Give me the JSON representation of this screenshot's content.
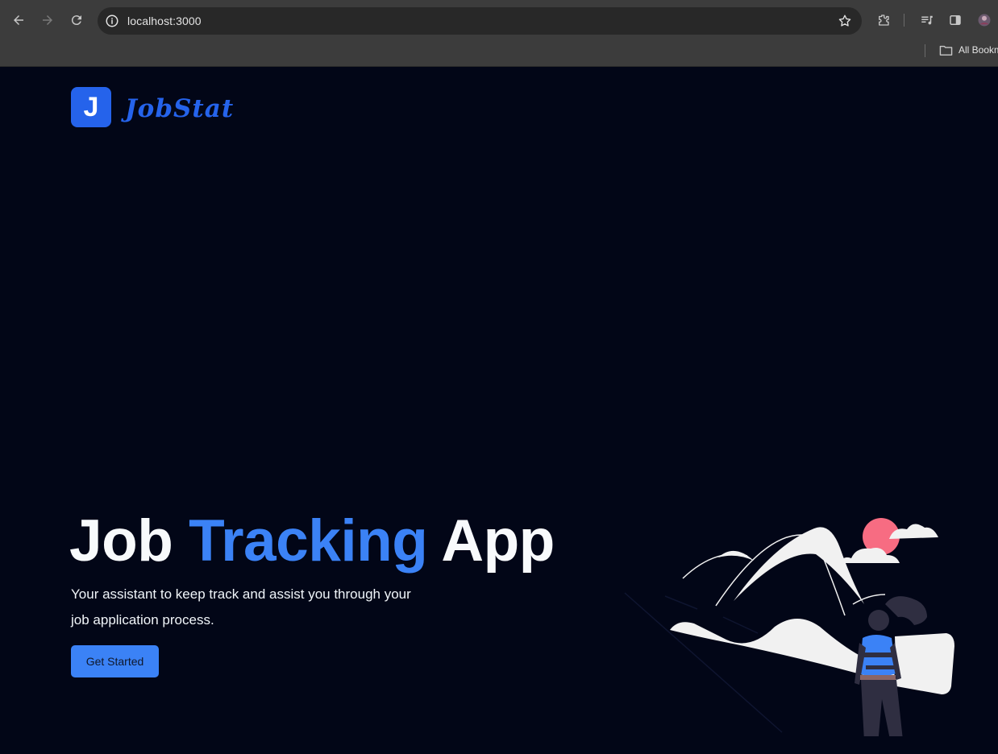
{
  "browser": {
    "url": "localhost:3000",
    "bookmarks_label": "All Bookm",
    "icons": [
      "back-arrow-icon",
      "forward-arrow-icon",
      "reload-icon",
      "info-icon",
      "star-icon",
      "extensions-icon",
      "media-control-icon",
      "side-panel-icon",
      "profile-avatar",
      "folder-icon"
    ]
  },
  "header": {
    "logo_letter": "J",
    "brand_name": "JobStat"
  },
  "hero": {
    "title_part1": "Job ",
    "title_accent": "Tracking",
    "title_part2": " App",
    "subtitle": "Your assistant to keep track and assist you through your job application process.",
    "cta_label": "Get Started"
  },
  "colors": {
    "page_bg": "#020617",
    "accent": "#3b82f6",
    "logo_bg": "#2563eb",
    "sun": "#f76c82",
    "chrome_bg": "#3c3c3c"
  }
}
